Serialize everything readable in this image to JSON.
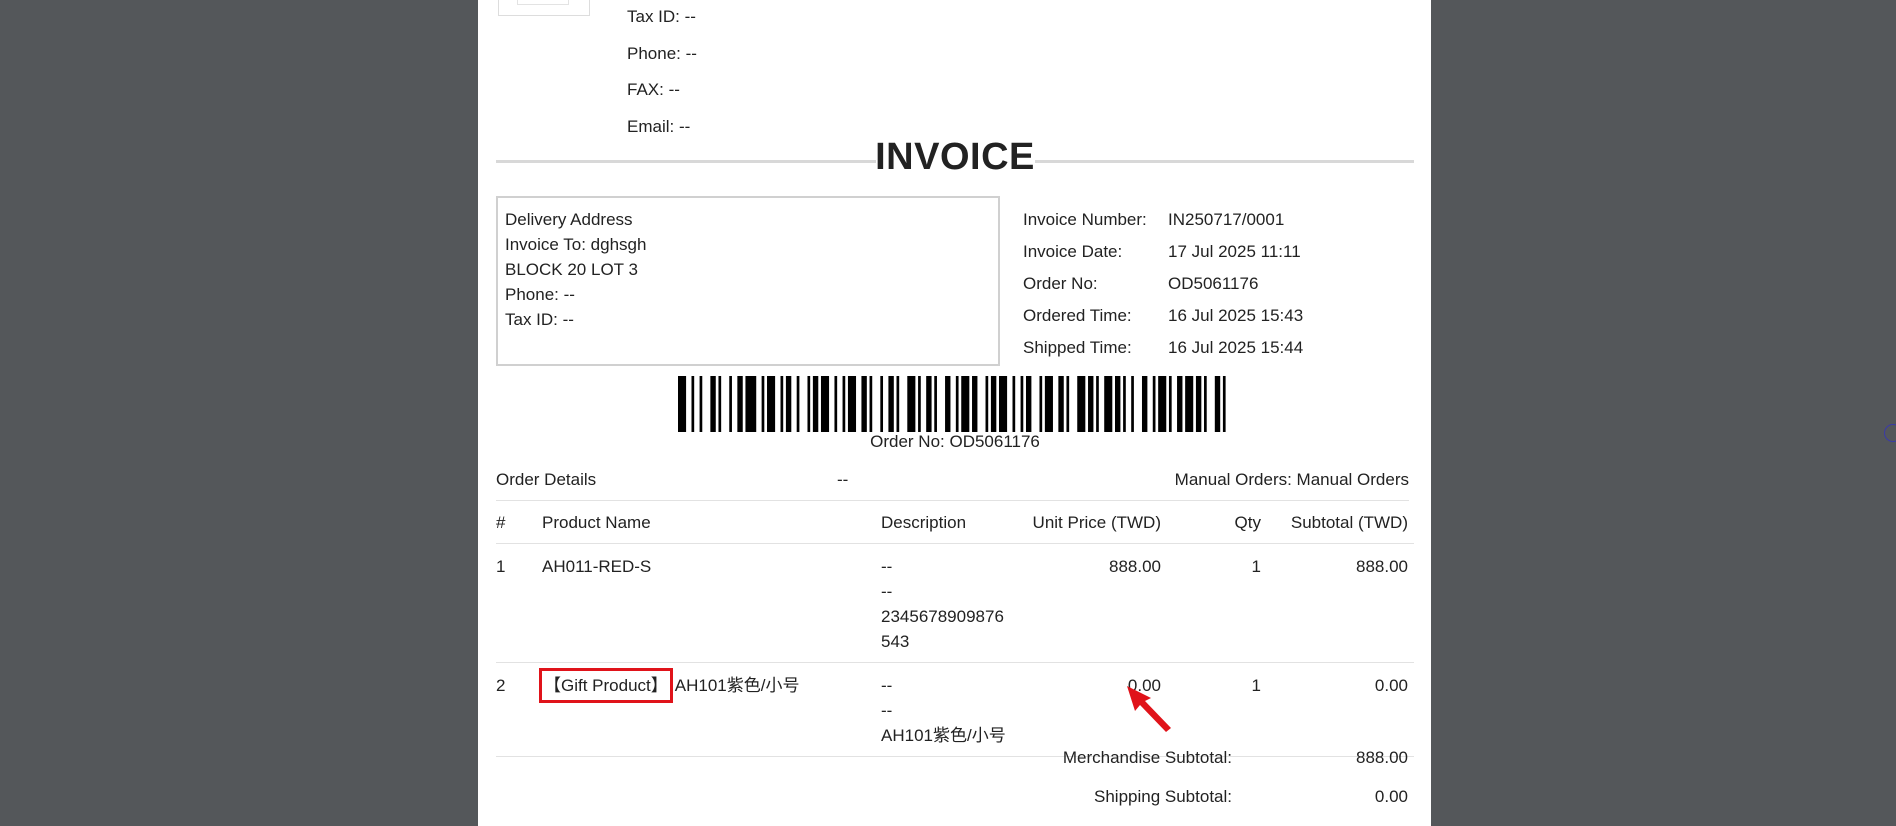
{
  "store": {
    "tax_id": "Tax ID: --",
    "phone": "Phone: --",
    "fax": "FAX: --",
    "email": "Email: --"
  },
  "title": "INVOICE",
  "delivery": {
    "heading": "Delivery Address",
    "invoice_to": "Invoice To: dghsgh",
    "address": "BLOCK 20 LOT 3",
    "phone": "Phone: --",
    "tax_id": "Tax ID: --"
  },
  "info": [
    {
      "label": "Invoice Number:",
      "value": "IN250717/0001"
    },
    {
      "label": "Invoice Date:",
      "value": "17 Jul 2025 11:11"
    },
    {
      "label": "Order No:",
      "value": "OD5061176"
    },
    {
      "label": "Ordered Time:",
      "value": "16 Jul 2025 15:43"
    },
    {
      "label": "Shipped Time:",
      "value": "16 Jul 2025 15:44"
    }
  ],
  "barcode_caption": "Order No:  OD5061176",
  "order_details": {
    "label": "Order Details",
    "middle": "--",
    "source": "Manual Orders: Manual Orders"
  },
  "table": {
    "headers": [
      "#",
      "Product Name",
      "Description",
      "Unit Price (TWD)",
      "Qty",
      "Subtotal (TWD)"
    ],
    "rows": [
      {
        "num": "1",
        "product": "AH011-RED-S",
        "tag": "",
        "desc": [
          "--",
          "--",
          "2345678909876",
          "543"
        ],
        "price": "888.00",
        "qty": "1",
        "subtotal": "888.00"
      },
      {
        "num": "2",
        "product": "AH101紫色/小号",
        "tag": "【Gift Product】",
        "desc": [
          "--",
          "--",
          "AH101紫色/小号"
        ],
        "price": "0.00",
        "qty": "1",
        "subtotal": "0.00"
      }
    ]
  },
  "totals": [
    {
      "label": "Merchandise Subtotal:",
      "value": "888.00"
    },
    {
      "label": "Shipping Subtotal:",
      "value": "0.00"
    }
  ],
  "colors": {
    "highlight": "#e0131a",
    "background": "#54575a"
  },
  "icons": {
    "annotation_arrow": "arrow-icon",
    "edge_widget": "circle-icon"
  }
}
